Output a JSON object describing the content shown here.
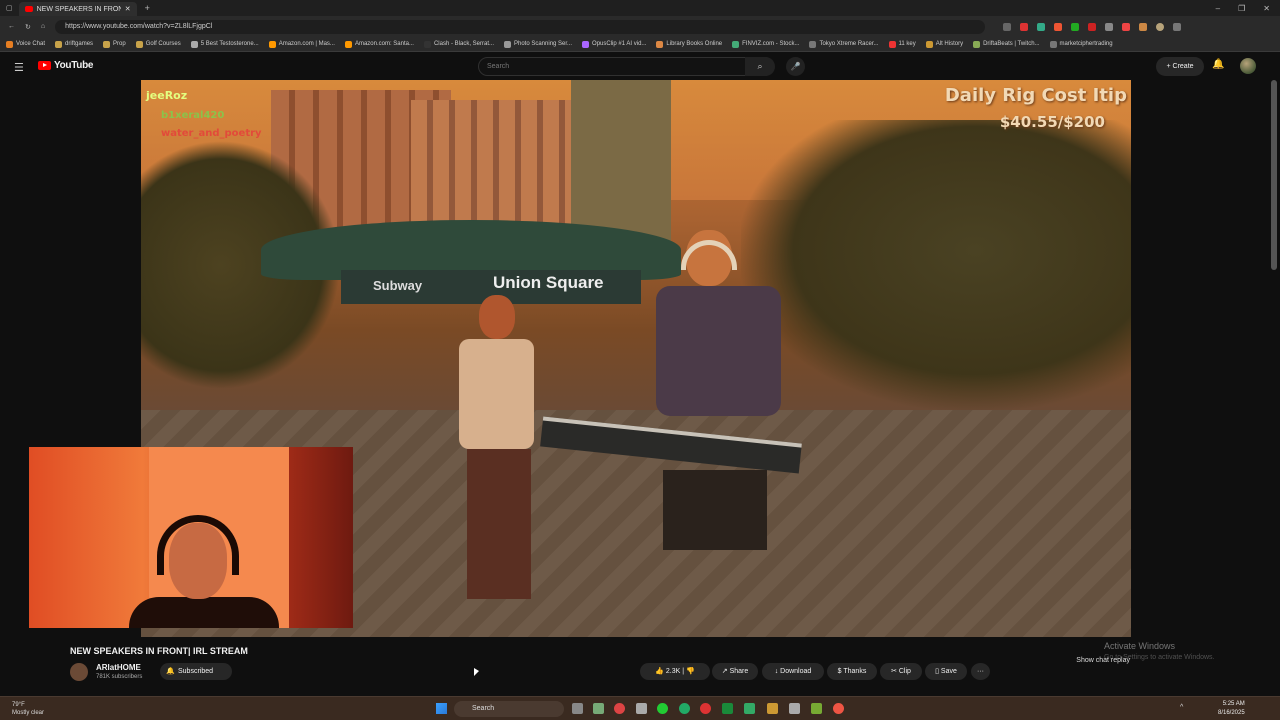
{
  "browser": {
    "tab_title": "NEW SPEAKERS IN FRONT! | IRL ST",
    "new_tab": "+",
    "window_controls": [
      "–",
      "❐",
      "✕"
    ],
    "url": "https://www.youtube.com/watch?v=ZL8lLFjgpCl"
  },
  "bookmarks": [
    "Voice Chat",
    "driftgames",
    "Prop",
    "Golf Courses",
    "5 Best Testosterone...",
    "Amazon.com | Mas...",
    "Amazon.com: Santa...",
    "Clash - Black, Serrat...",
    "Photo Scanning Ser...",
    "OpusClip #1 AI vid...",
    "Library Books Online",
    "FINVIZ.com - Stock...",
    "Tokyo Xtreme Racer...",
    "11 key",
    "Alt History",
    "DriftaBeats | Twitch...",
    "marketciphertrading"
  ],
  "youtube": {
    "logo_text": "YouTube",
    "search_placeholder": "Search",
    "create_label": "Create"
  },
  "overlay": {
    "rig_title": "Daily Rig Cost Itip",
    "rig_amount": "$40.55/$200",
    "chat_user1": "jeeRoz",
    "chat_user2": "b1xeral420",
    "chat_user3": "water_and_poetry"
  },
  "video": {
    "sign_subway": "Subway",
    "sign_square": "Union Square",
    "title": "NEW SPEAKERS IN FRONT| IRL STREAM",
    "channel": "ARIatHOME",
    "subscribers": "781K subscribers",
    "subscribe_label": "Subscribed",
    "likes": "2.3K",
    "share": "Share",
    "download": "Download",
    "thanks": "Thanks",
    "clip": "Clip",
    "save": "Save",
    "more": "···",
    "chat_replay": "Show chat replay"
  },
  "windows": {
    "activate_title": "Activate Windows",
    "activate_sub": "Go to Settings to activate Windows.",
    "weather_temp": "79°F",
    "weather_desc": "Mostly clear",
    "search_label": "Search",
    "time": "5:25 AM",
    "date": "8/16/2025"
  }
}
